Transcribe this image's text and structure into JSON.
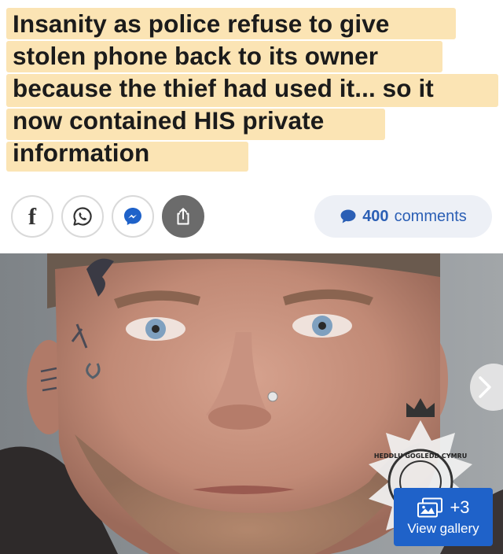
{
  "article": {
    "headline_lines": [
      "Insanity as police refuse to give",
      "stolen phone back to its owner",
      "because the thief had used it... so it",
      "now contained HIS private",
      "information"
    ],
    "highlight_color": "#fbe4b4"
  },
  "share": {
    "buttons": [
      {
        "icon": "facebook-icon",
        "label": "f"
      },
      {
        "icon": "whatsapp-icon"
      },
      {
        "icon": "messenger-icon"
      },
      {
        "icon": "share-upload-icon"
      }
    ]
  },
  "comments": {
    "count": "400",
    "label": "comments",
    "icon": "speech-bubble-icon",
    "accent": "#2b5fb5"
  },
  "gallery": {
    "extra_count": "+3",
    "label": "View gallery",
    "icon": "image-stack-icon",
    "button_color": "#1f62c9"
  },
  "photo": {
    "badge_text": "HEDDLU GOGLEDD CYMRU",
    "next_icon": "chevron-right-icon"
  }
}
